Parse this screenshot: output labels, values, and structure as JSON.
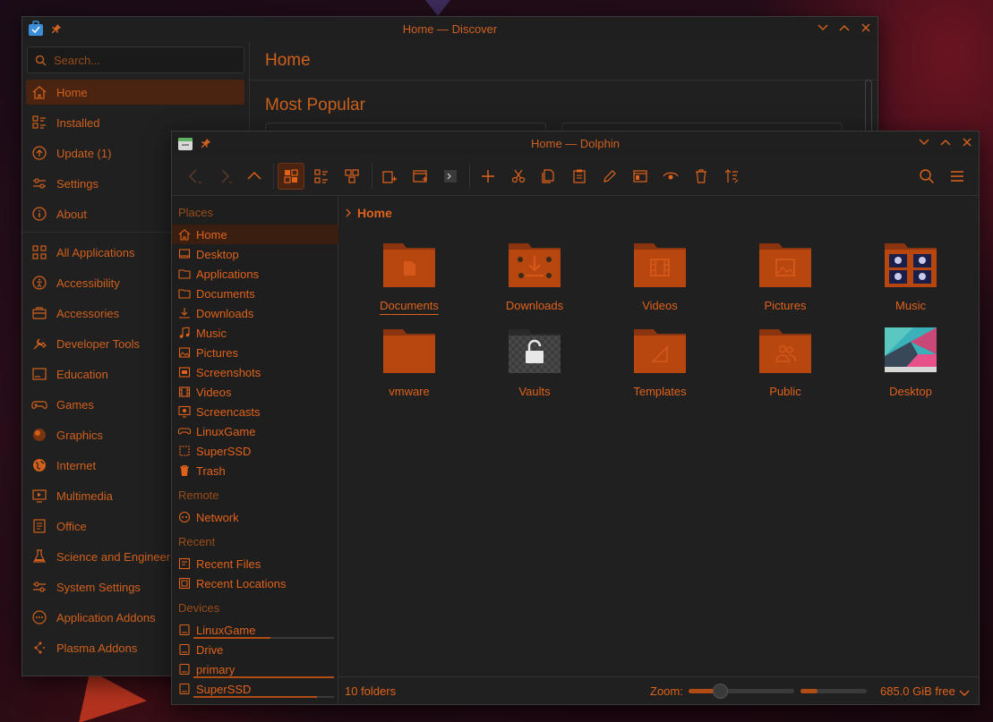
{
  "discover": {
    "title": "Home — Discover",
    "search_placeholder": "Search...",
    "page_title": "Home",
    "section_title": "Most Popular",
    "nav_top": [
      {
        "label": "Home",
        "icon": "home-icon",
        "active": true
      },
      {
        "label": "Installed",
        "icon": "installed-icon"
      },
      {
        "label": "Update (1)",
        "icon": "update-icon"
      },
      {
        "label": "Settings",
        "icon": "settings-icon"
      },
      {
        "label": "About",
        "icon": "info-icon"
      }
    ],
    "categories": [
      {
        "label": "All Applications",
        "icon": "all-apps-icon"
      },
      {
        "label": "Accessibility",
        "icon": "accessibility-icon"
      },
      {
        "label": "Accessories",
        "icon": "accessories-icon"
      },
      {
        "label": "Developer Tools",
        "icon": "developer-tools-icon"
      },
      {
        "label": "Education",
        "icon": "education-icon"
      },
      {
        "label": "Games",
        "icon": "games-icon"
      },
      {
        "label": "Graphics",
        "icon": "graphics-icon"
      },
      {
        "label": "Internet",
        "icon": "internet-icon"
      },
      {
        "label": "Multimedia",
        "icon": "multimedia-icon"
      },
      {
        "label": "Office",
        "icon": "office-icon"
      },
      {
        "label": "Science and Engineering",
        "icon": "science-icon"
      },
      {
        "label": "System Settings",
        "icon": "system-settings-icon"
      },
      {
        "label": "Application Addons",
        "icon": "addons-icon"
      },
      {
        "label": "Plasma Addons",
        "icon": "plasma-addons-icon"
      }
    ]
  },
  "dolphin": {
    "title": "Home — Dolphin",
    "breadcrumb": "Home",
    "places_header": "Places",
    "places": [
      {
        "label": "Home",
        "icon": "home-icon",
        "active": true
      },
      {
        "label": "Desktop",
        "icon": "desktop-icon"
      },
      {
        "label": "Applications",
        "icon": "folder-icon"
      },
      {
        "label": "Documents",
        "icon": "folder-icon"
      },
      {
        "label": "Downloads",
        "icon": "download-icon"
      },
      {
        "label": "Music",
        "icon": "music-icon"
      },
      {
        "label": "Pictures",
        "icon": "picture-icon"
      },
      {
        "label": "Screenshots",
        "icon": "screenshot-icon"
      },
      {
        "label": "Videos",
        "icon": "video-icon"
      },
      {
        "label": "Screencasts",
        "icon": "screencast-icon"
      },
      {
        "label": "LinuxGame",
        "icon": "gamepad-icon"
      },
      {
        "label": "SuperSSD",
        "icon": "drive-icon"
      },
      {
        "label": "Trash",
        "icon": "trash-icon"
      }
    ],
    "remote_header": "Remote",
    "remote": [
      {
        "label": "Network",
        "icon": "network-icon"
      }
    ],
    "recent_header": "Recent",
    "recent": [
      {
        "label": "Recent Files",
        "icon": "recent-files-icon"
      },
      {
        "label": "Recent Locations",
        "icon": "recent-locations-icon"
      }
    ],
    "devices_header": "Devices",
    "devices": [
      {
        "label": "LinuxGame",
        "icon": "hdd-icon",
        "usage": 0.55
      },
      {
        "label": "Drive",
        "icon": "hdd-icon"
      },
      {
        "label": "primary",
        "icon": "hdd-icon",
        "usage": 1.0
      },
      {
        "label": "SuperSSD",
        "icon": "hdd-icon",
        "usage": 0.88
      }
    ],
    "files": [
      {
        "label": "Documents",
        "type": "folder",
        "emblem": "document",
        "selected": true
      },
      {
        "label": "Downloads",
        "type": "folder",
        "emblem": "download"
      },
      {
        "label": "Videos",
        "type": "folder",
        "emblem": "video"
      },
      {
        "label": "Pictures",
        "type": "folder",
        "emblem": "picture"
      },
      {
        "label": "Music",
        "type": "folder",
        "emblem": "music"
      },
      {
        "label": "vmware",
        "type": "folder",
        "emblem": "none"
      },
      {
        "label": "Vaults",
        "type": "vault",
        "emblem": "lock"
      },
      {
        "label": "Templates",
        "type": "folder",
        "emblem": "template"
      },
      {
        "label": "Public",
        "type": "folder",
        "emblem": "public"
      },
      {
        "label": "Desktop",
        "type": "desktop",
        "emblem": "wallpaper"
      }
    ],
    "status": {
      "folder_count": "10 folders",
      "zoom_label": "Zoom:",
      "zoom_level": 0.3,
      "free_space": "685.0 GiB free",
      "disk_usage": 0.25
    }
  },
  "colors": {
    "accent": "#e0621a",
    "accent_dark": "#b04c14",
    "folder": "#b8460f",
    "folder_tab": "#d4581a",
    "selection": "#4a2411",
    "window_bg": "#202020"
  }
}
